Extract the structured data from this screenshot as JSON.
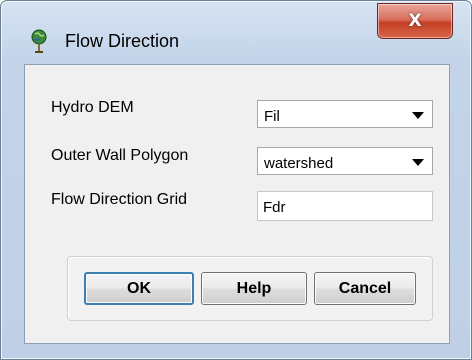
{
  "window": {
    "title": "Flow Direction",
    "close_label": "X"
  },
  "fields": {
    "hydro_dem": {
      "label": "Hydro DEM",
      "value": "Fil"
    },
    "outer_wall": {
      "label": "Outer Wall Polygon",
      "value": "watershed"
    },
    "flow_direction_grid": {
      "label": "Flow Direction Grid",
      "value": "Fdr"
    }
  },
  "buttons": {
    "ok": "OK",
    "help": "Help",
    "cancel": "Cancel"
  },
  "icons": {
    "app": "globe-pin-icon",
    "close": "close-icon",
    "dropdown": "chevron-down-icon"
  },
  "colors": {
    "close_red": "#c43f25",
    "focus_blue": "#3c7fb1",
    "frame_blue": "#c3d4e9"
  }
}
